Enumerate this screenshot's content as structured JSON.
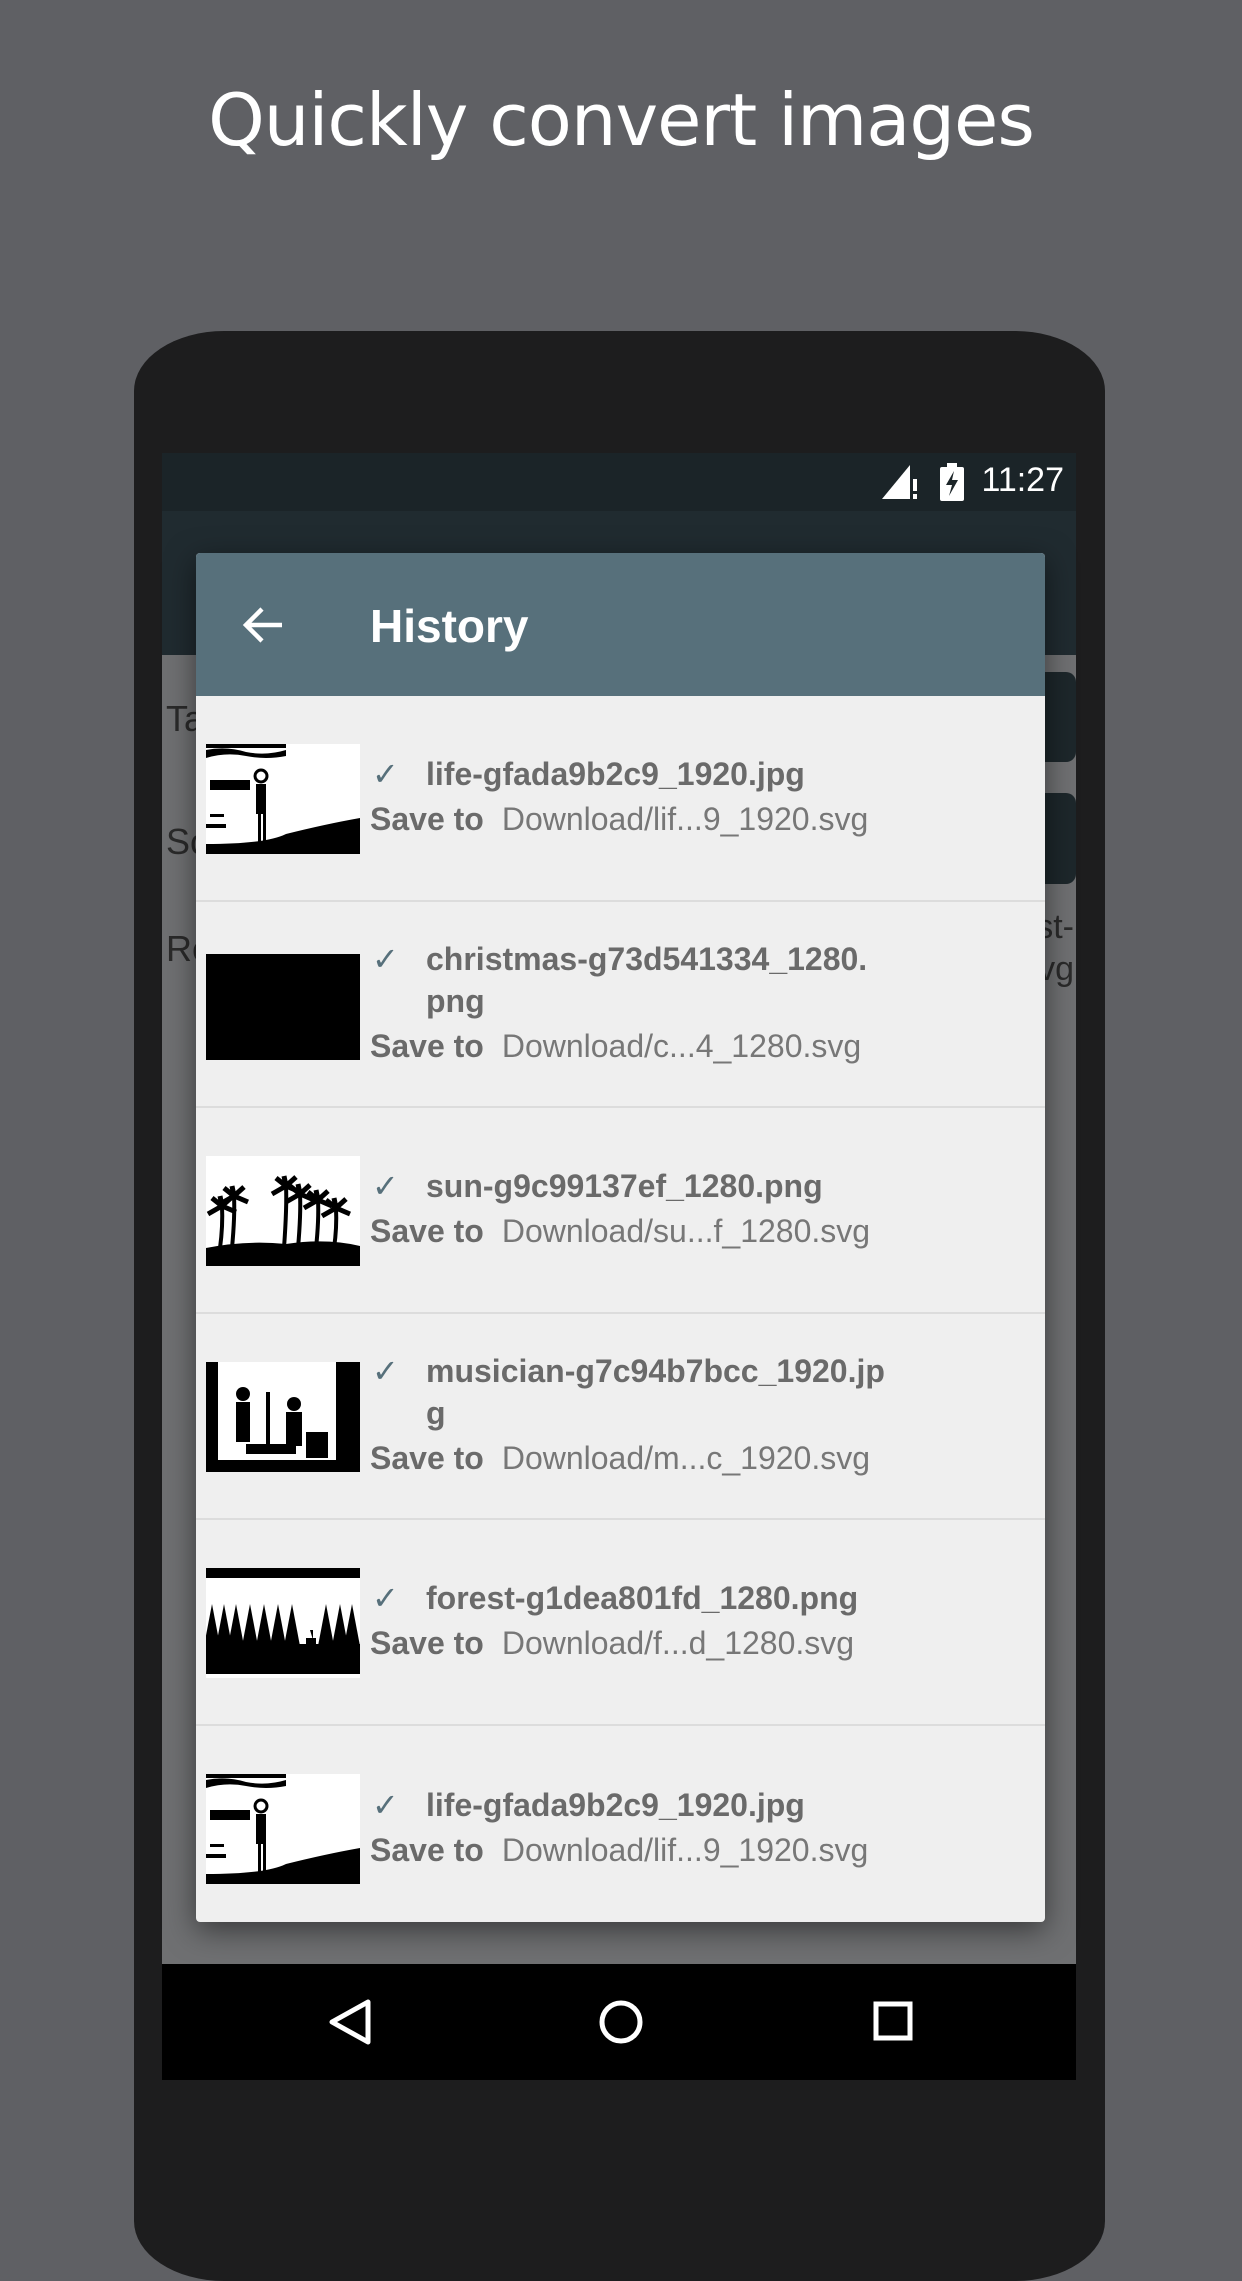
{
  "headline": "Quickly convert images",
  "status_bar": {
    "time": "11:27",
    "icons": [
      "signal-icon",
      "battery-charging-icon"
    ]
  },
  "background_screen": {
    "labels": [
      "Ta",
      "Sc",
      "Re"
    ],
    "right_text": [
      "st-",
      "vg"
    ]
  },
  "dialog": {
    "title": "History",
    "back_icon": "arrow-left-icon",
    "save_label": "Save to",
    "items": [
      {
        "name": "life-gfada9b2c9_1920.jpg",
        "path": "Download/lif...9_1920.svg",
        "thumb": "life"
      },
      {
        "name": "christmas-g73d541334_1280.png",
        "path": "Download/c...4_1280.svg",
        "thumb": "black"
      },
      {
        "name": "sun-g9c99137ef_1280.png",
        "path": "Download/su...f_1280.svg",
        "thumb": "palms"
      },
      {
        "name": "musician-g7c94b7bcc_1920.jpg",
        "path": "Download/m...c_1920.svg",
        "thumb": "musician"
      },
      {
        "name": "forest-g1dea801fd_1280.png",
        "path": "Download/f...d_1280.svg",
        "thumb": "forest"
      },
      {
        "name": "life-gfada9b2c9_1920.jpg",
        "path": "Download/lif...9_1920.svg",
        "thumb": "life"
      }
    ]
  },
  "nav_bar": {
    "icons": [
      "back-triangle-icon",
      "home-circle-icon",
      "recents-square-icon"
    ]
  },
  "colors": {
    "dialog_header": "#57707b",
    "dialog_body": "#efefef",
    "check": "#57707b",
    "page_bg": "#5f6064"
  }
}
